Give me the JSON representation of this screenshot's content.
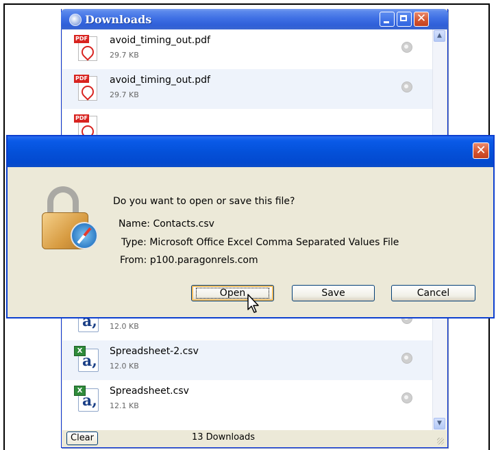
{
  "downloads": {
    "title": "Downloads",
    "items": [
      {
        "name": "avoid_timing_out.pdf",
        "size": "29.7 KB",
        "type": "pdf",
        "icon": "pdf-file-icon",
        "tag": "PDF"
      },
      {
        "name": "avoid_timing_out.pdf",
        "size": "29.7 KB",
        "type": "pdf",
        "icon": "pdf-file-icon",
        "tag": "PDF"
      },
      {
        "name": "",
        "size": "",
        "type": "pdf",
        "icon": "pdf-file-icon",
        "tag": "PDF"
      },
      {
        "name": "",
        "size": "12.0 KB",
        "type": "csv",
        "icon": "csv-file-icon",
        "tag": "X",
        "glyph": "a,"
      },
      {
        "name": "Spreadsheet-2.csv",
        "size": "12.0 KB",
        "type": "csv",
        "icon": "csv-file-icon",
        "tag": "X",
        "glyph": "a,"
      },
      {
        "name": "Spreadsheet.csv",
        "size": "12.1 KB",
        "type": "csv",
        "icon": "csv-file-icon",
        "tag": "X",
        "glyph": "a,"
      }
    ],
    "clear_label": "Clear",
    "count_label": "13 Downloads"
  },
  "dialog": {
    "question": "Do you want to open or save this file?",
    "name_line": "Name: Contacts.csv",
    "type_line": "Type: Microsoft Office Excel Comma Separated Values File",
    "from_line": "From: p100.paragonrels.com",
    "buttons": {
      "open": "Open",
      "save": "Save",
      "cancel": "Cancel"
    },
    "close_glyph": "✕"
  },
  "window_controls": {
    "close_glyph": "✕"
  },
  "colors": {
    "titlebar_blue": "#0451d9",
    "dialog_bg": "#ece9d8",
    "close_red": "#d3532e",
    "row_alt": "#eef3fb"
  }
}
